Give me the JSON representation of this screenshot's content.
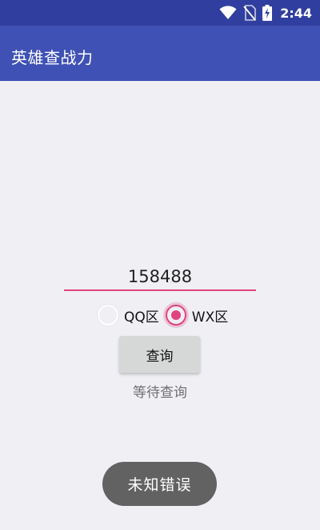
{
  "status_bar": {
    "time": "2:44",
    "icons": [
      "wifi-icon",
      "no-sim-icon",
      "battery-charging-icon"
    ]
  },
  "app_bar": {
    "title": "英雄查战力"
  },
  "form": {
    "input_value": "158488",
    "radios": [
      {
        "label": "QQ区",
        "checked": false
      },
      {
        "label": "WX区",
        "checked": true
      }
    ],
    "query_button_label": "查询",
    "status_text": "等待查询"
  },
  "toast": {
    "text": "未知错误"
  },
  "colors": {
    "status_bar": "#303f9f",
    "app_bar": "#3f51b5",
    "accent": "#e0447d",
    "background": "#f0eff4",
    "button": "#d6d7d7",
    "toast": "#626262"
  }
}
